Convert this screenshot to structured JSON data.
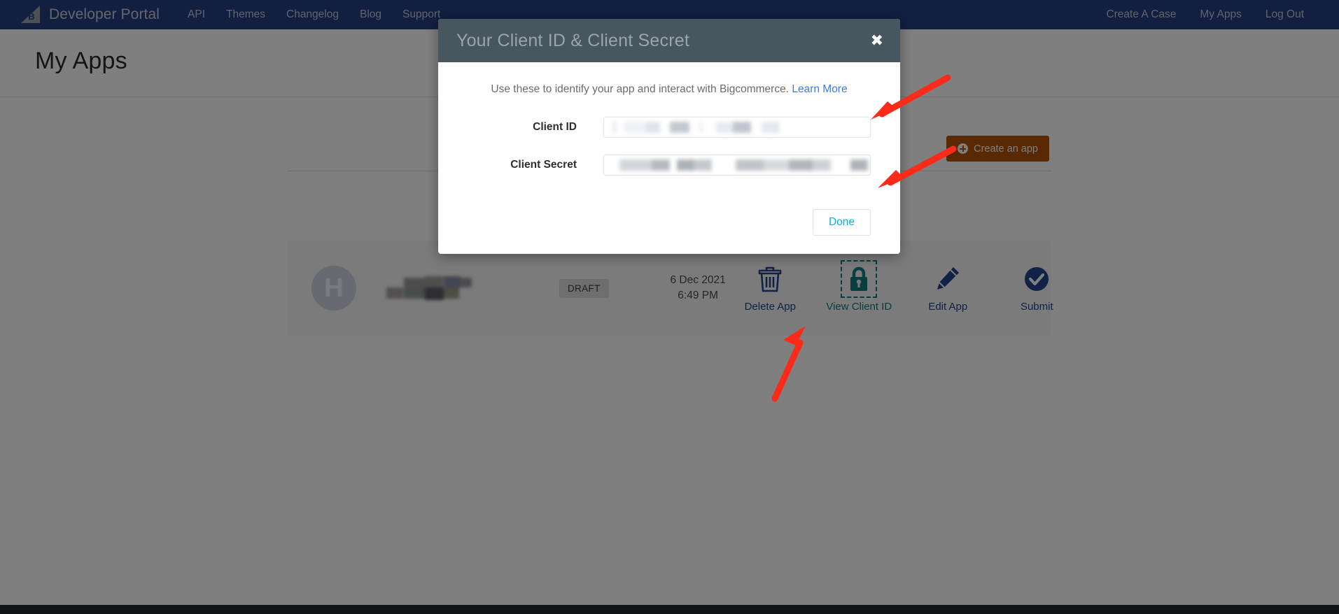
{
  "navbar": {
    "brand": "Developer Portal",
    "logo_icon": "bigcommerce-logo-icon",
    "links": [
      {
        "label": "API"
      },
      {
        "label": "Themes"
      },
      {
        "label": "Changelog"
      },
      {
        "label": "Blog"
      },
      {
        "label": "Support"
      }
    ],
    "right_links": [
      {
        "label": "Create A Case"
      },
      {
        "label": "My Apps"
      },
      {
        "label": "Log Out"
      }
    ],
    "bg_color": "#243E80"
  },
  "header": {
    "title": "My Apps"
  },
  "toolbar": {
    "create_app_label": "Create an app",
    "create_app_icon": "plus-circle-icon",
    "create_app_color": "#b35309"
  },
  "app_row": {
    "avatar_letter": "H",
    "app_name": "",
    "app_name_redacted": true,
    "status_badge": "DRAFT",
    "date": "6 Dec 2021",
    "time": "6:49 PM",
    "actions": [
      {
        "label": "Delete App",
        "icon": "trash-icon",
        "color": "#22448c",
        "focused": false
      },
      {
        "label": "View Client ID",
        "icon": "lock-icon",
        "color": "#0d7c83",
        "focused": true
      },
      {
        "label": "Edit App",
        "icon": "pencil-icon",
        "color": "#22448c",
        "focused": false
      },
      {
        "label": "Submit",
        "icon": "check-circle-icon",
        "color": "#22448c",
        "focused": false
      }
    ]
  },
  "modal": {
    "title": "Your Client ID & Client Secret",
    "close_icon": "close-icon",
    "close_label": "✖",
    "description_text": "Use these to identify your app and interact with Bigcommerce.",
    "description_link": "Learn More",
    "fields": [
      {
        "label": "Client ID",
        "value": "",
        "redacted": true
      },
      {
        "label": "Client Secret",
        "value": "",
        "redacted": true
      }
    ],
    "done_label": "Done",
    "done_color": "#00b5d8",
    "header_bg": "#485660"
  },
  "annotations": {
    "arrow_color": "#fc2a18",
    "arrows": [
      {
        "name": "arrow-to-client-id",
        "points_to": "client-id-field"
      },
      {
        "name": "arrow-to-client-secret",
        "points_to": "client-secret-field"
      },
      {
        "name": "arrow-to-view-client-id",
        "points_to": "view-client-id-action"
      }
    ]
  }
}
